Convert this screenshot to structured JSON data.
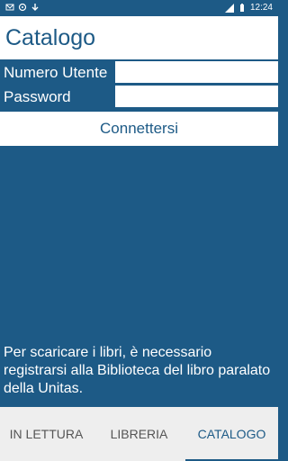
{
  "status": {
    "time": "12:24",
    "colors": {
      "bar": "#1d5a86"
    }
  },
  "app": {
    "title": "Catalogo"
  },
  "login": {
    "user_label": "Numero Utente",
    "user_value": "",
    "password_label": "Password",
    "password_value": "",
    "connect_label": "Connettersi"
  },
  "message": "Per scaricare i libri, è necessario registrarsi alla Biblioteca del libro paralato della Unitas.",
  "tabs": [
    {
      "label": "IN LETTURA"
    },
    {
      "label": "LIBRERIA"
    },
    {
      "label": "CATALOGO",
      "selected": true
    }
  ],
  "colors": {
    "accent": "#1d5a86",
    "background": "#ffffff",
    "tab_bg": "#eeeeee"
  }
}
